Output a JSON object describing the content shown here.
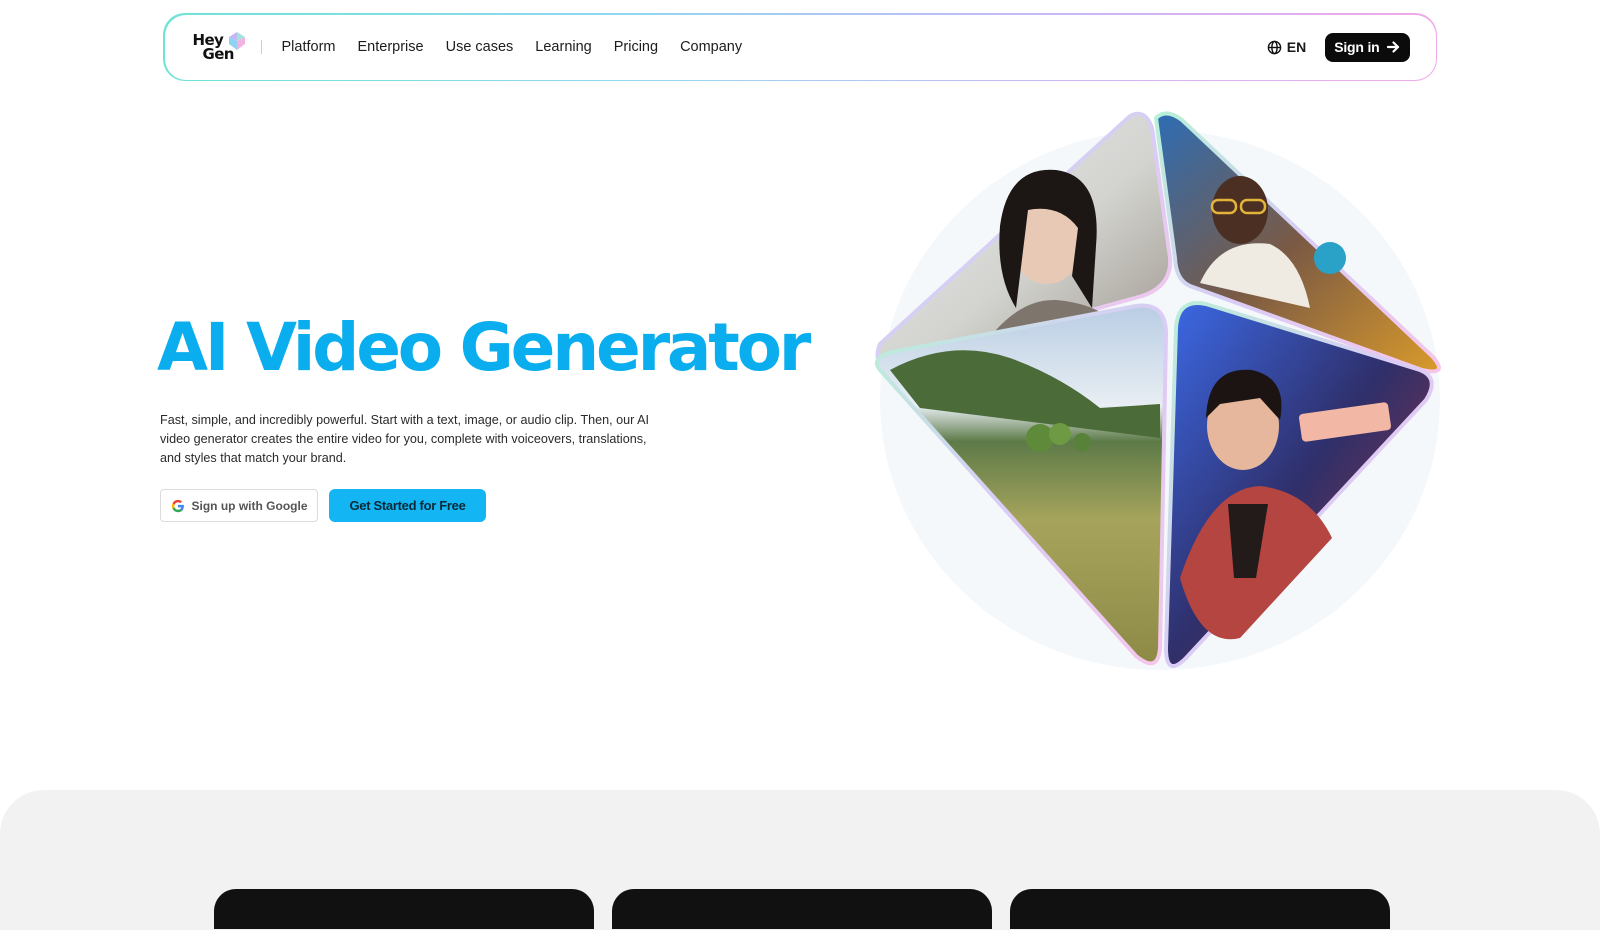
{
  "brand": {
    "logo_line1": "Hey",
    "logo_line2": "Gen"
  },
  "nav": {
    "links": [
      "Platform",
      "Enterprise",
      "Use cases",
      "Learning",
      "Pricing",
      "Company"
    ],
    "language": "EN",
    "signin_label": "Sign in",
    "icons": {
      "language": "globe-icon",
      "signin": "arrow-right-icon",
      "logo": "heygen-cube-icon"
    }
  },
  "hero": {
    "title": "AI Video Generator",
    "description": "Fast, simple, and incredibly powerful. Start with a text, image, or audio clip. Then, our AI video generator creates the entire video for you, complete with voiceovers, translations, and styles that match your brand.",
    "google_button_label": "Sign up with Google",
    "start_button_label": "Get Started for Free",
    "visual_tiles": [
      "woman-portrait",
      "man-with-glasses-portrait",
      "landscape-field",
      "man-red-shirt-portrait"
    ]
  },
  "colors": {
    "accent": "#0aaeee",
    "button_primary": "#13b6f2",
    "signin_bg": "#0b0b0b",
    "section_bg": "#f2f2f2"
  }
}
